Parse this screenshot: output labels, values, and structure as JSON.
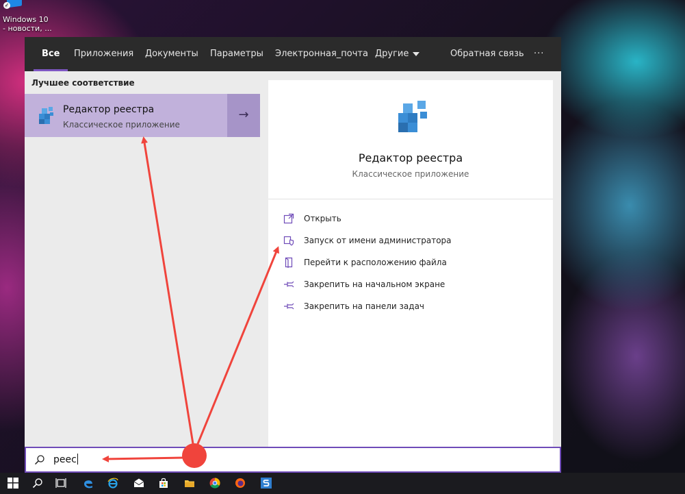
{
  "desktop": {
    "icon_name": "desktop-shortcut-icon",
    "label": "Windows 10\n- новости, ..."
  },
  "tabs": [
    {
      "label": "Все",
      "active": true
    },
    {
      "label": "Приложения"
    },
    {
      "label": "Документы"
    },
    {
      "label": "Параметры"
    },
    {
      "label": "Электронная_почта"
    },
    {
      "label": "Другие",
      "dropdown": true
    },
    {
      "label": "Обратная связь"
    },
    {
      "label": "···"
    }
  ],
  "left_pane": {
    "section_title": "Лучшее соответствие",
    "best_match": {
      "title": "Редактор реестра",
      "subtitle": "Классическое приложение",
      "icon": "registry-editor-icon",
      "arrow_icon": "arrow-right-icon"
    }
  },
  "right_pane": {
    "title": "Редактор реестра",
    "subtitle": "Классическое приложение",
    "icon": "registry-editor-icon",
    "actions": [
      {
        "label": "Открыть",
        "icon": "open-icon"
      },
      {
        "label": "Запуск от имени администратора",
        "icon": "shield-icon"
      },
      {
        "label": "Перейти к расположению файла",
        "icon": "file-location-icon"
      },
      {
        "label": "Закрепить на начальном экране",
        "icon": "pin-icon"
      },
      {
        "label": "Закрепить на панели задач",
        "icon": "pin-icon"
      }
    ]
  },
  "search": {
    "value": "реес",
    "icon": "search-icon"
  },
  "taskbar": {
    "items": [
      "windows-start-icon",
      "search-icon",
      "task-view-icon",
      "edge-icon",
      "ie-icon",
      "mail-icon",
      "store-icon",
      "file-explorer-icon",
      "chrome-icon",
      "firefox-icon",
      "app-s-icon"
    ]
  },
  "colors": {
    "accent": "#7e57c2",
    "best_match_bg": "#c1b1db",
    "tabbar_bg": "#2b2b2b",
    "annotation": "#f0443c"
  }
}
